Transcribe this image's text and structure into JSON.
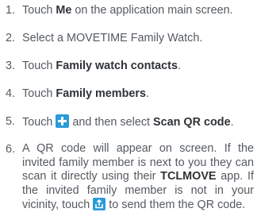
{
  "steps": [
    {
      "num": "1.",
      "pre": "Touch ",
      "bold": "Me",
      "post": " on the application main screen."
    },
    {
      "num": "2.",
      "text": "Select a MOVETIME Family Watch."
    },
    {
      "num": "3.",
      "pre": "Touch ",
      "bold": "Family watch contacts",
      "post": "."
    },
    {
      "num": "4.",
      "pre": "Touch ",
      "bold": "Family members",
      "post": "."
    },
    {
      "num": "5.",
      "pre": "Touch ",
      "mid": " and then select ",
      "bold": "Scan QR code",
      "post": "."
    },
    {
      "num": "6.",
      "pre": "A QR code will appear on screen. If the invited family member is next to you they can scan it directly using their ",
      "bold": "TCLMOVE",
      "mid": " app. If the invited family member is not in your vicinity, touch ",
      "post": " to send them the QR code."
    }
  ],
  "icons": {
    "add": "plus-icon",
    "send": "share-icon"
  },
  "colors": {
    "text": "#555a60",
    "bold_text": "#2f3337",
    "icon_blue": "#2b9ad9"
  }
}
